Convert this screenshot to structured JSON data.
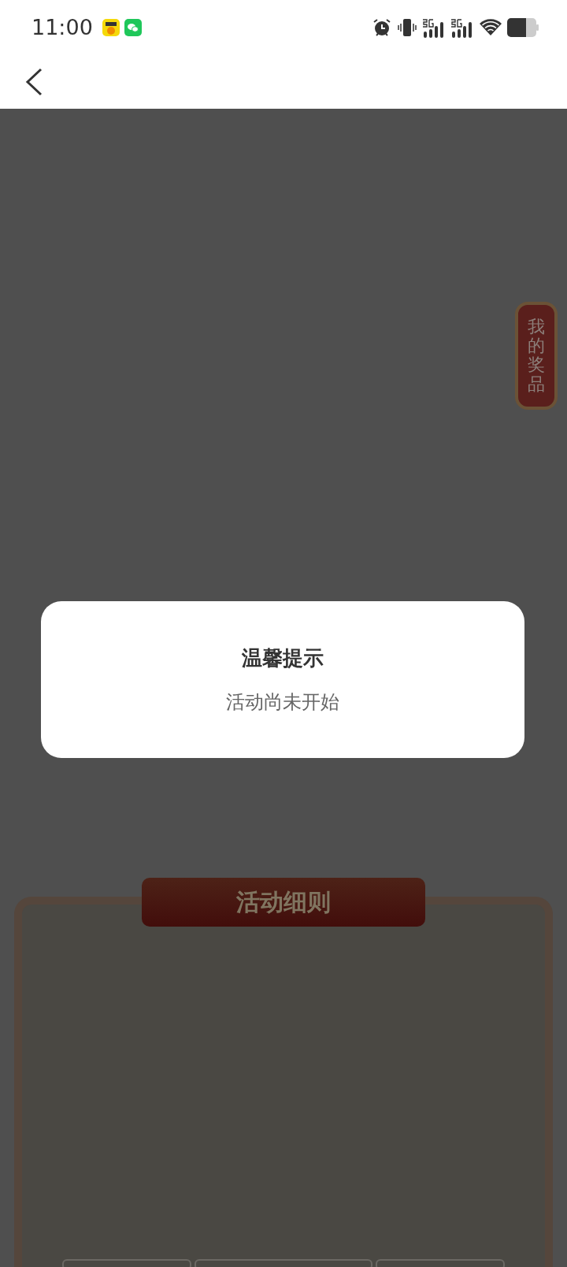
{
  "status_bar": {
    "time": "11:00"
  },
  "side_badge": {
    "label": "我的奖品"
  },
  "dialog": {
    "title": "温馨提示",
    "message": "活动尚未开始"
  },
  "rules_panel": {
    "title": "活动细则"
  }
}
